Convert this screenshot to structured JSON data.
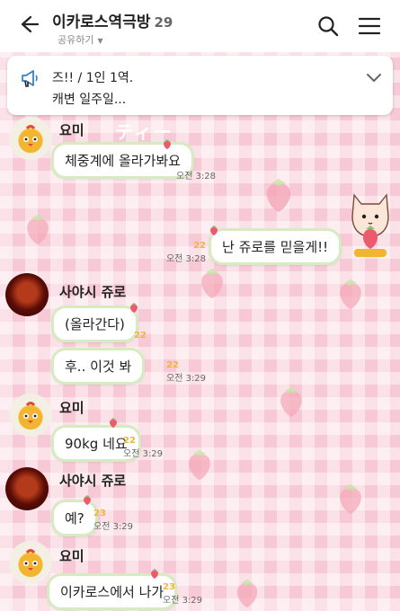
{
  "header": {
    "title": "이카로스역극방",
    "member_count": "29",
    "share_label": "공유하기",
    "icons": {
      "back": "back-arrow-icon",
      "search": "search-icon",
      "menu": "hamburger-menu-icon"
    }
  },
  "notice": {
    "line1": "즈!! / 1인 1역.",
    "line2": "캐변 일주일...",
    "icon": "megaphone-icon"
  },
  "decoration": {
    "text": "ティー"
  },
  "messages": [
    {
      "sender": "요미",
      "text": "체중계에 올라가봐요",
      "time": "오전 3:28",
      "unread": ""
    },
    {
      "sender": "",
      "text": "난 쥬로를    믿을게!!",
      "time": "오전 3:28",
      "unread": "22"
    },
    {
      "sender": "사야시 쥬로",
      "text": "(올라간다)",
      "time": "",
      "unread": "22"
    },
    {
      "sender": "",
      "text": "후.. 이것  봐",
      "time": "오전 3:29",
      "unread": "22"
    },
    {
      "sender": "요미",
      "text": "90kg 네요",
      "time": "오전 3:29",
      "unread": "22"
    },
    {
      "sender": "사야시 쥬로",
      "text": "예?",
      "time": "오전 3:29",
      "unread": "23"
    },
    {
      "sender": "요미",
      "text": "이카로스에서 나가",
      "time": "오전 3:29",
      "unread": "23"
    }
  ],
  "colors": {
    "background": "#f7c9d6",
    "bubble_border": "#d6ebc0",
    "unread": "#f0b441",
    "strawberry": "#ec5a6e"
  }
}
